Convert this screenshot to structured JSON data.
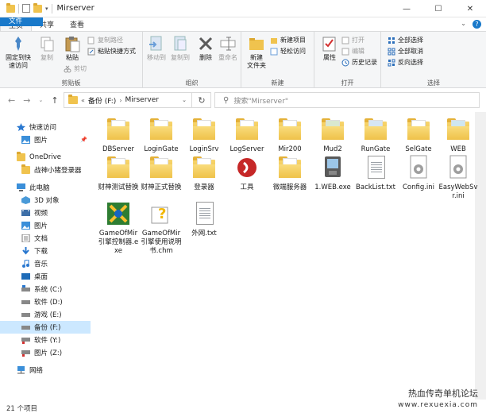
{
  "window": {
    "title": "Mirserver",
    "min": "—",
    "max": "☐",
    "close": "✕"
  },
  "ribbon_tabs": [
    "文件",
    "主页",
    "共享",
    "查看"
  ],
  "ribbon": {
    "clipboard": {
      "pin": "固定到快\n速访问",
      "copy": "复制",
      "paste": "粘贴",
      "copy_path": "复制路径",
      "paste_shortcut": "粘贴快捷方式",
      "cut": "剪切",
      "label": "剪贴板"
    },
    "organize": {
      "move_to": "移动到",
      "copy_to": "复制到",
      "delete": "删除",
      "rename": "重命名",
      "label": "组织"
    },
    "new": {
      "new_folder": "新建\n文件夹",
      "new_item": "新建项目",
      "easy_access": "轻松访问",
      "label": "新建"
    },
    "open": {
      "properties": "属性",
      "open": "打开",
      "edit": "编辑",
      "history": "历史记录",
      "label": "打开"
    },
    "select": {
      "select_all": "全部选择",
      "select_none": "全部取消",
      "invert": "反向选择",
      "label": "选择"
    }
  },
  "address": {
    "prefix": "«",
    "crumbs": [
      "备份 (F:)",
      "Mirserver"
    ],
    "search_placeholder": "搜索\"Mirserver\""
  },
  "nav": {
    "quick_access": "快速访问",
    "pictures_pinned": "图片",
    "onedrive": "OneDrive",
    "folder": "战神小猪登录器",
    "this_pc": "此电脑",
    "objects3d": "3D 对象",
    "videos": "视频",
    "pictures": "图片",
    "documents": "文档",
    "downloads": "下载",
    "music": "音乐",
    "desktop": "桌面",
    "drive_c": "系统 (C:)",
    "drive_d": "软件 (D:)",
    "drive_e": "游戏 (E:)",
    "drive_f": "备份 (F:)",
    "drive_y": "软件 (Y:)",
    "drive_z": "图片 (Z:)",
    "network": "网络"
  },
  "files": [
    {
      "name": "DBServer",
      "type": "folder"
    },
    {
      "name": "LoginGate",
      "type": "folder"
    },
    {
      "name": "LoginSrv",
      "type": "folder"
    },
    {
      "name": "LogServer",
      "type": "folder"
    },
    {
      "name": "Mir200",
      "type": "folder"
    },
    {
      "name": "Mud2",
      "type": "folder"
    },
    {
      "name": "RunGate",
      "type": "folder"
    },
    {
      "name": "SelGate",
      "type": "folder"
    },
    {
      "name": "WEB",
      "type": "folder"
    },
    {
      "name": "财神测试替换",
      "type": "folder"
    },
    {
      "name": "财神正式替换",
      "type": "folder"
    },
    {
      "name": "登录器",
      "type": "folder"
    },
    {
      "name": "工具",
      "type": "folder"
    },
    {
      "name": "微端服务器",
      "type": "folder"
    },
    {
      "name": "1.WEB.exe",
      "type": "exe"
    },
    {
      "name": "BackList.txt",
      "type": "txt"
    },
    {
      "name": "Config.ini",
      "type": "ini"
    },
    {
      "name": "EasyWebSvr.ini",
      "type": "ini"
    },
    {
      "name": "GameOfMir引擎控制器.exe",
      "type": "exe"
    },
    {
      "name": "GameOfMir引擎使用说明书.chm",
      "type": "chm"
    },
    {
      "name": "外网.txt",
      "type": "txt"
    }
  ],
  "status": {
    "count": "21 个项目"
  },
  "watermark": {
    "line1": "热血传奇单机论坛",
    "line2": "www.rexuexia.com"
  },
  "colors": {
    "accent": "#1979ca",
    "selected": "#cce8ff",
    "folder": "#f0c34e"
  }
}
